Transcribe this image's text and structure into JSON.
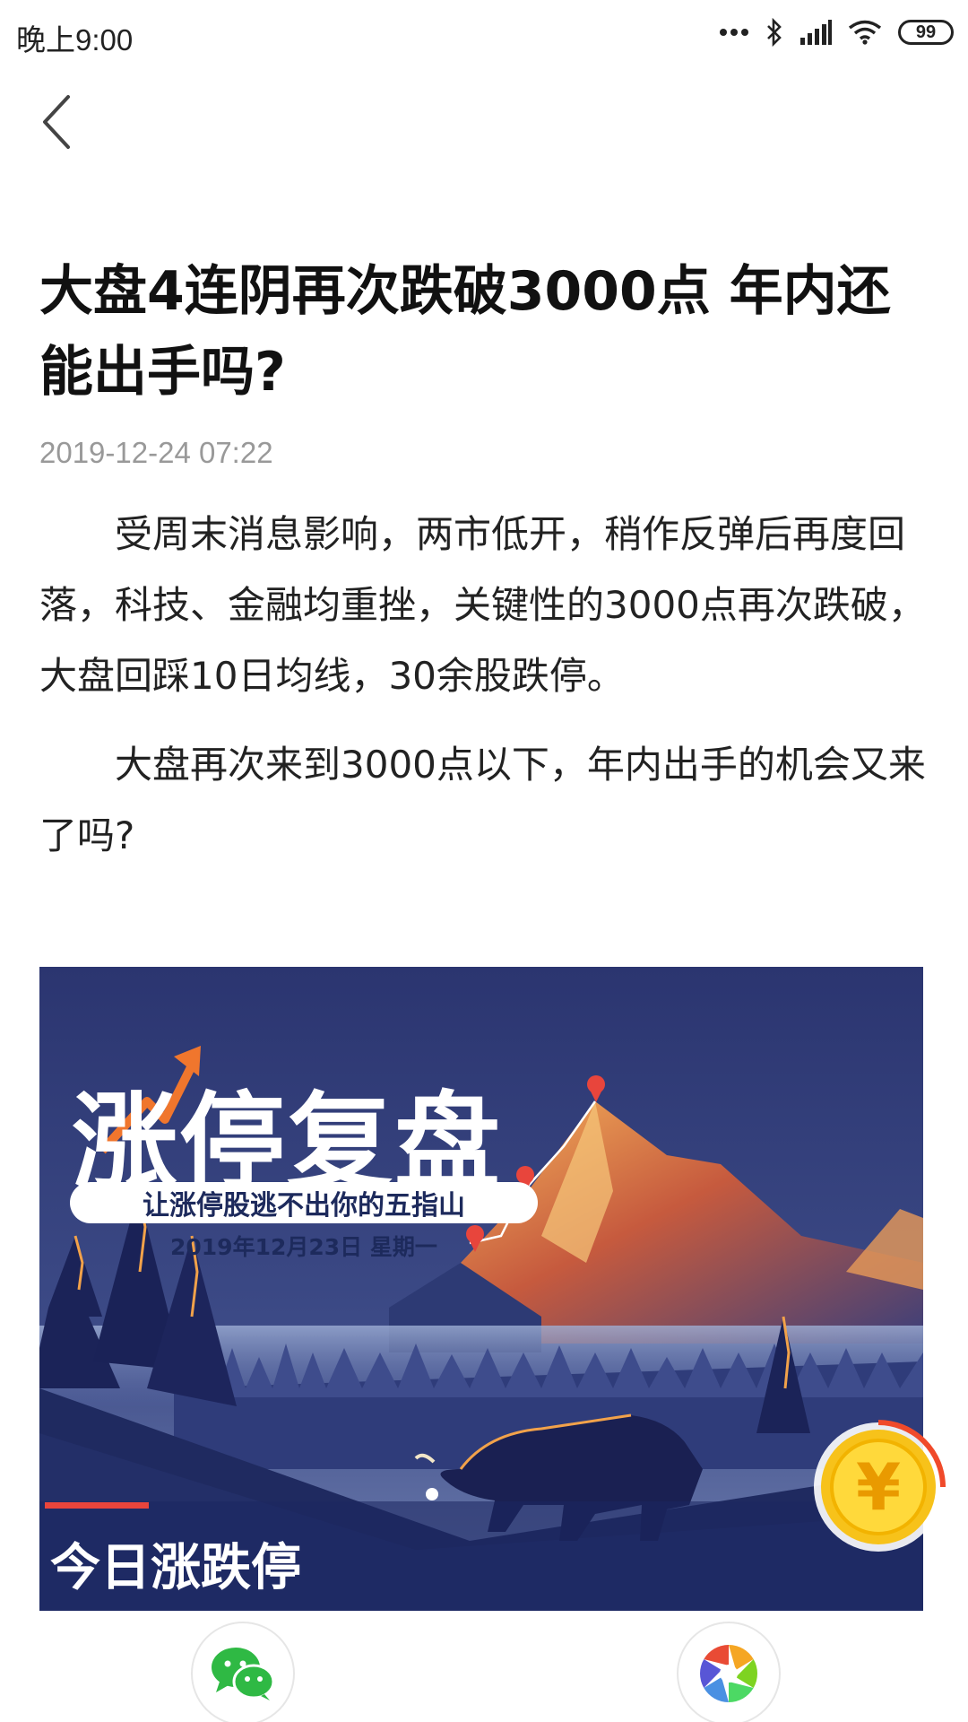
{
  "status_bar": {
    "time": "晚上9:00",
    "battery": "99",
    "icons": [
      "more-dots-icon",
      "bluetooth-icon",
      "signal-icon",
      "wifi-icon",
      "battery-icon"
    ]
  },
  "nav": {
    "back_icon": "chevron-left-icon"
  },
  "article": {
    "title": "大盘4连阴再次跌破3000点 年内还能出手吗?",
    "date": "2019-12-24 07:22",
    "paragraphs": [
      "受周末消息影响，两市低开，稍作反弹后再度回落，科技、金融均重挫，关键性的3000点再次跌破，大盘回踩10日均线，30余股跌停。",
      "大盘再次来到3000点以下，年内出手的机会又来了吗?"
    ]
  },
  "banner": {
    "title": "涨停复盘",
    "slogan": "让涨停股逃不出你的五指山",
    "date": "2019年12月23日 星期一",
    "subtitle": "今日涨跌停",
    "colors": {
      "sky": "#2b3570",
      "mountain_glow": "#f2a24a",
      "accent_red": "#e8453c"
    }
  },
  "floating": {
    "coin_symbol": "¥",
    "coin_icon": "yuan-coin-icon"
  },
  "share": {
    "wechat_icon": "wechat-icon",
    "moments_icon": "moments-icon"
  }
}
